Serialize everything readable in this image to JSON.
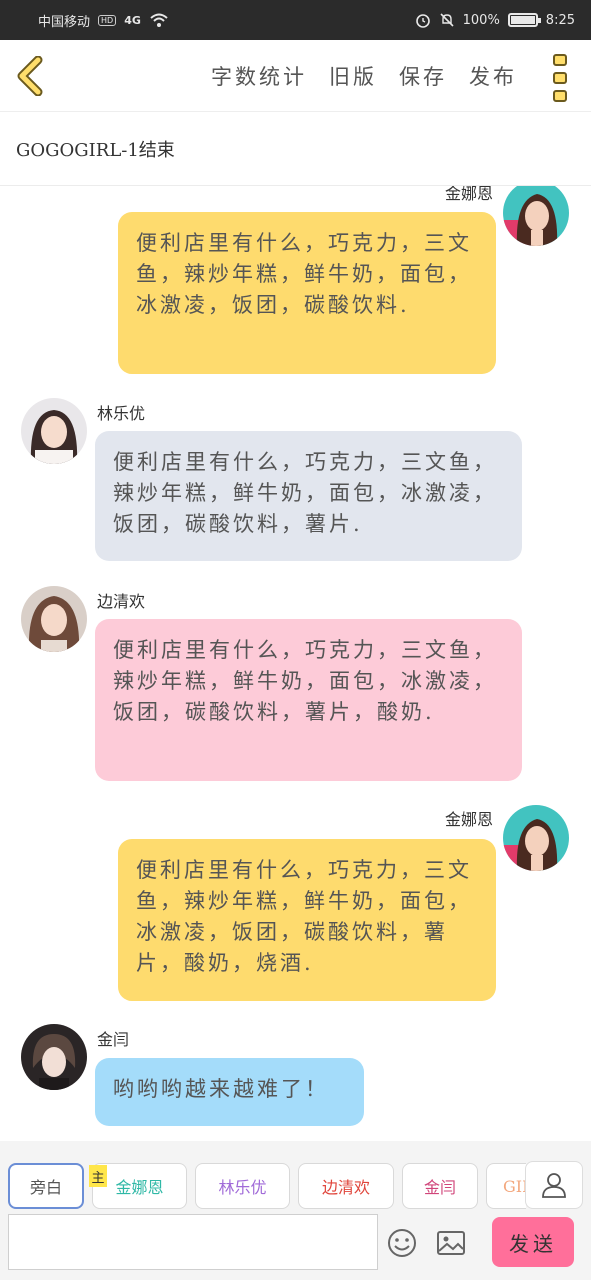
{
  "status_bar": {
    "carrier": "中国移动",
    "hd": "HD",
    "network": "4G",
    "battery": "100%",
    "battery_level": 1.0,
    "time": "8:25"
  },
  "toolbar": {
    "actions": [
      "字数统计",
      "旧版",
      "保存",
      "发布"
    ]
  },
  "page_title": "GOGOGIRL-1结束",
  "messages": [
    {
      "side": "right",
      "name": "金娜恩",
      "color": "#fedb6e",
      "text": "便利店里有什么，巧克力，三文鱼，辣炒年糕，鲜牛奶，面包，冰激凌，饭团，碳酸饮料."
    },
    {
      "side": "left",
      "name": "林乐优",
      "color": "#e2e6ee",
      "text": "便利店里有什么，巧克力，三文鱼，辣炒年糕，鲜牛奶，面包，冰激凌，饭团，碳酸饮料，薯片."
    },
    {
      "side": "left",
      "name": "边清欢",
      "color": "#fdcbd8",
      "text": "便利店里有什么，巧克力，三文鱼，辣炒年糕，鲜牛奶，面包，冰激凌，饭团，碳酸饮料，薯片，酸奶."
    },
    {
      "side": "right",
      "name": "金娜恩",
      "color": "#fedb6e",
      "text": "便利店里有什么，巧克力，三文鱼，辣炒年糕，鲜牛奶，面包，冰激凌，饭团，碳酸饮料，薯片，酸奶，烧酒."
    },
    {
      "side": "left",
      "name": "金闫",
      "color": "#a4dcfa",
      "text": "哟哟哟越来越难了！"
    }
  ],
  "characters": [
    {
      "label": "旁白",
      "color": "#555555"
    },
    {
      "label": "金娜恩",
      "color": "#2fb8a6"
    },
    {
      "label": "林乐优",
      "color": "#a06ad8"
    },
    {
      "label": "边清欢",
      "color": "#e0463c"
    },
    {
      "label": "金闫",
      "color": "#d0457a"
    },
    {
      "label": "GIF",
      "color": "#f3a77d"
    }
  ],
  "main_tag": "主",
  "send_label": "发送",
  "input_placeholder": ""
}
